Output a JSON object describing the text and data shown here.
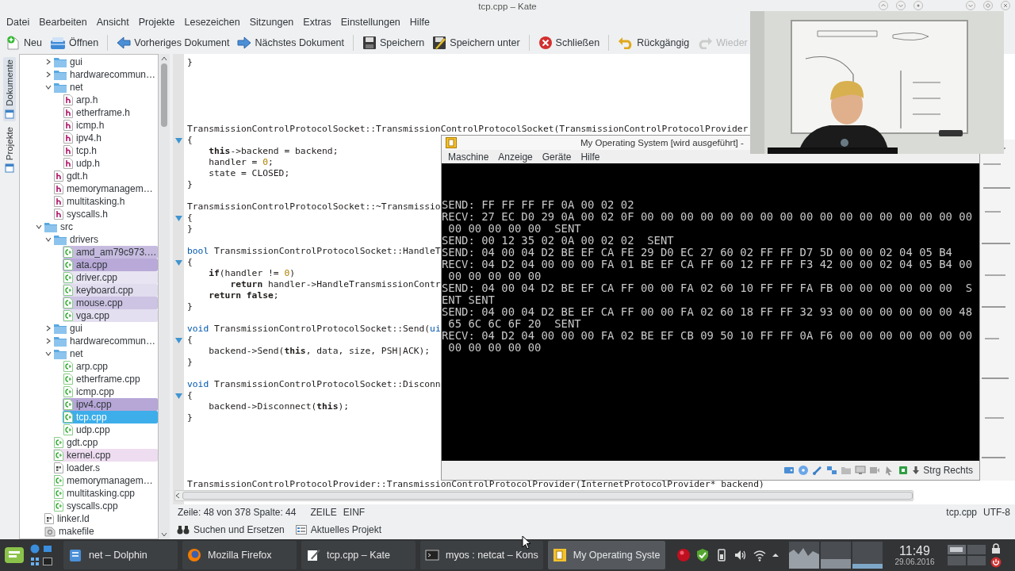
{
  "window": {
    "title": "tcp.cpp – Kate"
  },
  "window_buttons": [
    {
      "kind": "keep-above"
    },
    {
      "kind": "keep-below"
    },
    {
      "kind": "all-desktops"
    },
    {
      "kind": "minimize"
    },
    {
      "kind": "maximize"
    },
    {
      "kind": "close"
    }
  ],
  "menu": [
    "Datei",
    "Bearbeiten",
    "Ansicht",
    "Projekte",
    "Lesezeichen",
    "Sitzungen",
    "Extras",
    "Einstellungen",
    "Hilfe"
  ],
  "toolbar_groups": [
    {
      "buttons": [
        {
          "label": "Neu",
          "kind": "new",
          "disabled": false
        },
        {
          "label": "Öffnen",
          "kind": "open",
          "disabled": false
        }
      ]
    },
    {
      "buttons": [
        {
          "label": "Vorheriges Dokument",
          "kind": "previous",
          "disabled": false
        },
        {
          "label": "Nächstes Dokument",
          "kind": "next",
          "disabled": false
        }
      ]
    },
    {
      "buttons": [
        {
          "label": "Speichern",
          "kind": "save",
          "disabled": false
        },
        {
          "label": "Speichern unter",
          "kind": "save-as",
          "disabled": false
        }
      ]
    },
    {
      "buttons": [
        {
          "label": "Schließen",
          "kind": "close",
          "disabled": false
        }
      ]
    },
    {
      "buttons": [
        {
          "label": "Rückgängig",
          "kind": "undo",
          "disabled": false
        },
        {
          "label": "Wieder",
          "kind": "redo",
          "disabled": true
        }
      ]
    }
  ],
  "side_tabs": [
    {
      "label": "Dokumente",
      "selected": true
    },
    {
      "label": "Projekte",
      "selected": false
    }
  ],
  "tree": {
    "hidden_parent_children": [
      {
        "label": "gui",
        "kind": "folder",
        "expanded": false,
        "selected": false
      },
      {
        "label": "hardwarecommun…",
        "kind": "folder",
        "expanded": false,
        "selected": false
      },
      {
        "label": "net",
        "kind": "folder",
        "expanded": true,
        "selected": false,
        "children": [
          {
            "label": "arp.h",
            "kind": "header",
            "selected": false
          },
          {
            "label": "etherframe.h",
            "kind": "header",
            "selected": false
          },
          {
            "label": "icmp.h",
            "kind": "header",
            "selected": false
          },
          {
            "label": "ipv4.h",
            "kind": "header",
            "selected": false
          },
          {
            "label": "tcp.h",
            "kind": "header",
            "selected": false
          },
          {
            "label": "udp.h",
            "kind": "header",
            "selected": false
          }
        ]
      },
      {
        "label": "gdt.h",
        "kind": "header",
        "selected": false
      },
      {
        "label": "memorymanagem…",
        "kind": "header",
        "selected": false
      },
      {
        "label": "multitasking.h",
        "kind": "header",
        "selected": false
      },
      {
        "label": "syscalls.h",
        "kind": "header",
        "selected": false
      }
    ],
    "items": [
      {
        "label": "src",
        "kind": "folder",
        "expanded": true,
        "selected": false,
        "children": [
          {
            "label": "drivers",
            "kind": "folder",
            "expanded": true,
            "selected": false,
            "children": [
              {
                "label": "amd_am79c973.…",
                "kind": "source",
                "selected": false,
                "color": "#c6bbdf"
              },
              {
                "label": "ata.cpp",
                "kind": "source",
                "selected": false,
                "color": "#b8a9d8"
              },
              {
                "label": "driver.cpp",
                "kind": "source",
                "selected": false,
                "color": "#e8e4f2"
              },
              {
                "label": "keyboard.cpp",
                "kind": "source",
                "selected": false,
                "color": "#e2dcef"
              },
              {
                "label": "mouse.cpp",
                "kind": "source",
                "selected": false,
                "color": "#cdc3e3"
              },
              {
                "label": "vga.cpp",
                "kind": "source",
                "selected": false,
                "color": "#e4dff0"
              }
            ]
          },
          {
            "label": "gui",
            "kind": "folder",
            "expanded": false,
            "selected": false
          },
          {
            "label": "hardwarecommun…",
            "kind": "folder",
            "expanded": false,
            "selected": false
          },
          {
            "label": "net",
            "kind": "folder",
            "expanded": true,
            "selected": false,
            "children": [
              {
                "label": "arp.cpp",
                "kind": "source",
                "selected": false
              },
              {
                "label": "etherframe.cpp",
                "kind": "source",
                "selected": false
              },
              {
                "label": "icmp.cpp",
                "kind": "source",
                "selected": false
              },
              {
                "label": "ipv4.cpp",
                "kind": "source",
                "selected": false,
                "color": "#b6a7d7"
              },
              {
                "label": "tcp.cpp",
                "kind": "source",
                "selected": true
              },
              {
                "label": "udp.cpp",
                "kind": "source",
                "selected": false
              }
            ]
          },
          {
            "label": "gdt.cpp",
            "kind": "source",
            "selected": false
          },
          {
            "label": "kernel.cpp",
            "kind": "source",
            "selected": false,
            "color": "#eedcf0"
          },
          {
            "label": "loader.s",
            "kind": "other",
            "selected": false
          },
          {
            "label": "memorymanagem…",
            "kind": "source",
            "selected": false
          },
          {
            "label": "multitasking.cpp",
            "kind": "source",
            "selected": false
          },
          {
            "label": "syscalls.cpp",
            "kind": "source",
            "selected": false
          }
        ]
      },
      {
        "label": "linker.ld",
        "kind": "other",
        "selected": false
      },
      {
        "label": "makefile",
        "kind": "makefile",
        "selected": false
      }
    ]
  },
  "editor": {
    "lines": [
      {
        "kind": "code",
        "fold": false,
        "tokens": [
          {
            "kind": "plain",
            "text": "}"
          }
        ]
      },
      {
        "kind": "blank",
        "fold": false
      },
      {
        "kind": "blank",
        "fold": false
      },
      {
        "kind": "blank",
        "fold": false
      },
      {
        "kind": "blank",
        "fold": false
      },
      {
        "kind": "blank",
        "fold": false
      },
      {
        "kind": "code",
        "fold": false,
        "tokens": [
          {
            "kind": "plain",
            "text": "TransmissionControlProtocolSocket::TransmissionControlProtocolSocket(TransmissionControlProtocolProvider"
          }
        ]
      },
      {
        "kind": "code",
        "fold": true,
        "tokens": [
          {
            "kind": "plain",
            "text": "{"
          }
        ]
      },
      {
        "kind": "code",
        "fold": false,
        "tokens": [
          {
            "kind": "keyword",
            "text": "    this"
          },
          {
            "kind": "plain",
            "text": "->backend = backend;"
          }
        ]
      },
      {
        "kind": "code",
        "fold": false,
        "tokens": [
          {
            "kind": "plain",
            "text": "    handler = "
          },
          {
            "kind": "number",
            "text": "0"
          },
          {
            "kind": "plain",
            "text": ";"
          }
        ]
      },
      {
        "kind": "code",
        "fold": false,
        "tokens": [
          {
            "kind": "plain",
            "text": "    state = CLOSED;"
          }
        ]
      },
      {
        "kind": "code",
        "fold": false,
        "tokens": [
          {
            "kind": "plain",
            "text": "}"
          }
        ]
      },
      {
        "kind": "blank",
        "fold": false
      },
      {
        "kind": "code",
        "fold": false,
        "tokens": [
          {
            "kind": "plain",
            "text": "TransmissionControlProtocolSocket::~Transmissio"
          }
        ]
      },
      {
        "kind": "code",
        "fold": true,
        "tokens": [
          {
            "kind": "plain",
            "text": "{"
          }
        ]
      },
      {
        "kind": "code",
        "fold": false,
        "tokens": [
          {
            "kind": "plain",
            "text": "}"
          }
        ]
      },
      {
        "kind": "blank",
        "fold": false
      },
      {
        "kind": "code",
        "fold": false,
        "tokens": [
          {
            "kind": "type",
            "text": "bool"
          },
          {
            "kind": "plain",
            "text": " TransmissionControlProtocolSocket::HandleT"
          }
        ]
      },
      {
        "kind": "code",
        "fold": true,
        "tokens": [
          {
            "kind": "plain",
            "text": "{"
          }
        ]
      },
      {
        "kind": "code",
        "fold": false,
        "tokens": [
          {
            "kind": "keyword",
            "text": "    if"
          },
          {
            "kind": "plain",
            "text": "(handler != "
          },
          {
            "kind": "number",
            "text": "0"
          },
          {
            "kind": "plain",
            "text": ")"
          }
        ]
      },
      {
        "kind": "code",
        "fold": false,
        "tokens": [
          {
            "kind": "keyword",
            "text": "        return"
          },
          {
            "kind": "plain",
            "text": " handler->HandleTransmissionContr"
          }
        ]
      },
      {
        "kind": "code",
        "fold": false,
        "tokens": [
          {
            "kind": "keyword",
            "text": "    return false"
          },
          {
            "kind": "plain",
            "text": ";"
          }
        ]
      },
      {
        "kind": "code",
        "fold": false,
        "tokens": [
          {
            "kind": "plain",
            "text": "}"
          }
        ]
      },
      {
        "kind": "blank",
        "fold": false
      },
      {
        "kind": "code",
        "fold": false,
        "tokens": [
          {
            "kind": "type",
            "text": "void"
          },
          {
            "kind": "plain",
            "text": " TransmissionControlProtocolSocket::Send("
          },
          {
            "kind": "type",
            "text": "ui"
          }
        ]
      },
      {
        "kind": "code",
        "fold": true,
        "tokens": [
          {
            "kind": "plain",
            "text": "{"
          }
        ]
      },
      {
        "kind": "code",
        "fold": false,
        "tokens": [
          {
            "kind": "plain",
            "text": "    backend->Send("
          },
          {
            "kind": "keyword",
            "text": "this"
          },
          {
            "kind": "plain",
            "text": ", data, size, PSH|ACK);"
          }
        ]
      },
      {
        "kind": "code",
        "fold": false,
        "tokens": [
          {
            "kind": "plain",
            "text": "}"
          }
        ]
      },
      {
        "kind": "blank",
        "fold": false
      },
      {
        "kind": "code",
        "fold": false,
        "tokens": [
          {
            "kind": "type",
            "text": "void"
          },
          {
            "kind": "plain",
            "text": " TransmissionControlProtocolSocket::Disconn"
          }
        ]
      },
      {
        "kind": "code",
        "fold": true,
        "tokens": [
          {
            "kind": "plain",
            "text": "{"
          }
        ]
      },
      {
        "kind": "code",
        "fold": false,
        "tokens": [
          {
            "kind": "plain",
            "text": "    backend->Disconnect("
          },
          {
            "kind": "keyword",
            "text": "this"
          },
          {
            "kind": "plain",
            "text": ");"
          }
        ]
      },
      {
        "kind": "code",
        "fold": false,
        "tokens": [
          {
            "kind": "plain",
            "text": "}"
          }
        ]
      },
      {
        "kind": "blank",
        "fold": false
      },
      {
        "kind": "blank",
        "fold": false
      },
      {
        "kind": "blank",
        "fold": false
      },
      {
        "kind": "blank",
        "fold": false
      },
      {
        "kind": "blank",
        "fold": false
      },
      {
        "kind": "code",
        "fold": false,
        "tokens": [
          {
            "kind": "plain",
            "text": "TransmissionControlProtocolProvider::TransmissionControlProtocolProvider(InternetProtocolProvider* backend)"
          }
        ]
      }
    ]
  },
  "status_bar": {
    "position": "Zeile: 48 von 378 Spalte: 44",
    "mode": "ZEILE",
    "insert": "EINF",
    "file": "tcp.cpp",
    "encoding": "UTF-8"
  },
  "tool_views": [
    {
      "label": "Suchen und Ersetzen",
      "kind": "search"
    },
    {
      "label": "Aktuelles Projekt",
      "kind": "project"
    }
  ],
  "vm_window": {
    "title": "My Operating System [wird ausgeführt] -",
    "menu": [
      "Maschine",
      "Anzeige",
      "Geräte",
      "Hilfe"
    ],
    "screen_lines": [
      "SEND: FF FF FF FF 0A 00 02 02",
      "RECV: 27 EC D0 29 0A 00 02 0F 00 00 00 00 00 00 00 00 00 00 00 00 00 00 00 00 00",
      " 00 00 00 00 00  SENT",
      "SEND: 00 12 35 02 0A 00 02 02  SENT",
      "SEND: 04 00 04 D2 BE EF CA FE 29 D0 EC 27 60 02 FF FF D7 5D 00 00 02 04 05 B4",
      "RECV: 04 D2 04 00 00 00 FA 01 BE EF CA FF 60 12 FF FF F3 42 00 00 02 04 05 B4 00",
      " 00 00 00 00 00",
      "SEND: 04 00 04 D2 BE EF CA FF 00 00 FA 02 60 10 FF FF FA FB 00 00 00 00 00 00  S",
      "ENT SENT",
      "SEND: 04 00 04 D2 BE EF CA FF 00 00 FA 02 60 18 FF FF 32 93 00 00 00 00 00 00 48",
      " 65 6C 6C 6F 20  SENT",
      "RECV: 04 D2 04 00 00 00 FA 02 BE EF CB 09 50 10 FF FF 0A F6 00 00 00 00 00 00 00",
      " 00 00 00 00 00"
    ],
    "status_icons": [
      {
        "kind": "disk"
      },
      {
        "kind": "disc"
      },
      {
        "kind": "usb"
      },
      {
        "kind": "network"
      },
      {
        "kind": "folder"
      },
      {
        "kind": "display"
      },
      {
        "kind": "capture"
      },
      {
        "kind": "mouse"
      },
      {
        "kind": "cpu"
      }
    ],
    "host_key": "Strg Rechts"
  },
  "webcam": {
    "kind": "picture"
  },
  "taskbar": {
    "tasks": [
      {
        "label": "net – Dolphin",
        "kind": "files",
        "selected": false
      },
      {
        "label": "Mozilla Firefox",
        "kind": "browser",
        "selected": false
      },
      {
        "label": "tcp.cpp – Kate",
        "kind": "editor",
        "selected": false
      },
      {
        "label": "myos : netcat – Kons",
        "kind": "terminal",
        "selected": false
      },
      {
        "label": "My Operating Syste",
        "kind": "vm",
        "selected": true
      }
    ],
    "clock": {
      "time": "11:49",
      "date": "29.06.2016"
    }
  }
}
